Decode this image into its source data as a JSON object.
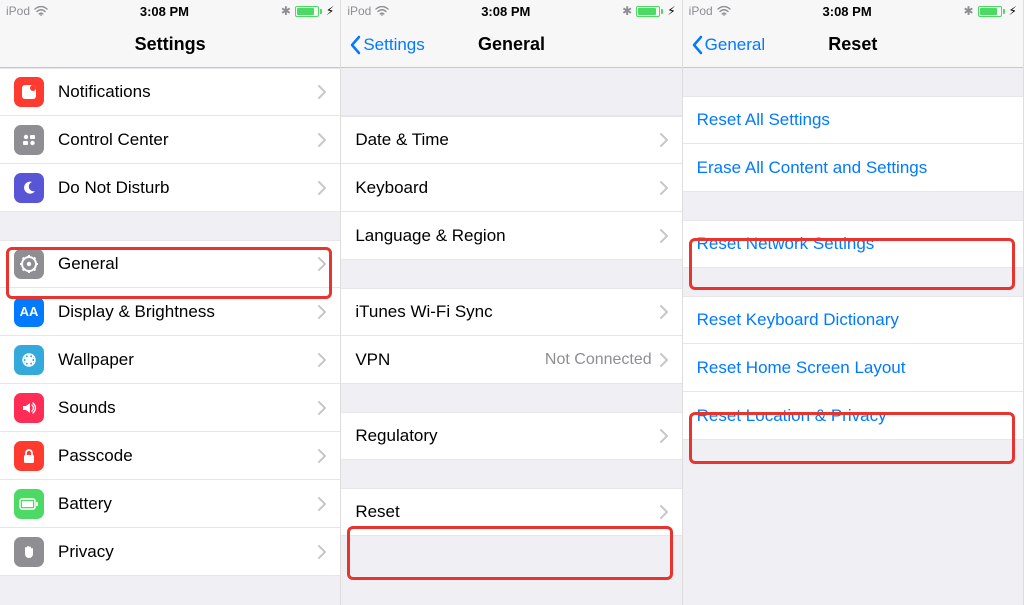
{
  "status": {
    "carrier": "iPod",
    "time": "3:08 PM",
    "bt": "✼",
    "charging": "⚡︎"
  },
  "screen1": {
    "title": "Settings",
    "rows": {
      "notifications": "Notifications",
      "control_center": "Control Center",
      "dnd": "Do Not Disturb",
      "general": "General",
      "display": "Display & Brightness",
      "wallpaper": "Wallpaper",
      "sounds": "Sounds",
      "passcode": "Passcode",
      "battery": "Battery",
      "privacy": "Privacy"
    }
  },
  "screen2": {
    "back": "Settings",
    "title": "General",
    "rows": {
      "date_time": "Date & Time",
      "keyboard": "Keyboard",
      "lang_region": "Language & Region",
      "wifi_sync": "iTunes Wi-Fi Sync",
      "vpn": "VPN",
      "vpn_val": "Not Connected",
      "regulatory": "Regulatory",
      "reset": "Reset"
    }
  },
  "screen3": {
    "back": "General",
    "title": "Reset",
    "rows": {
      "reset_all": "Reset All Settings",
      "erase_all": "Erase All Content and Settings",
      "reset_network": "Reset Network Settings",
      "reset_keyboard": "Reset Keyboard Dictionary",
      "reset_home": "Reset Home Screen Layout",
      "reset_location": "Reset Location & Privacy"
    }
  }
}
